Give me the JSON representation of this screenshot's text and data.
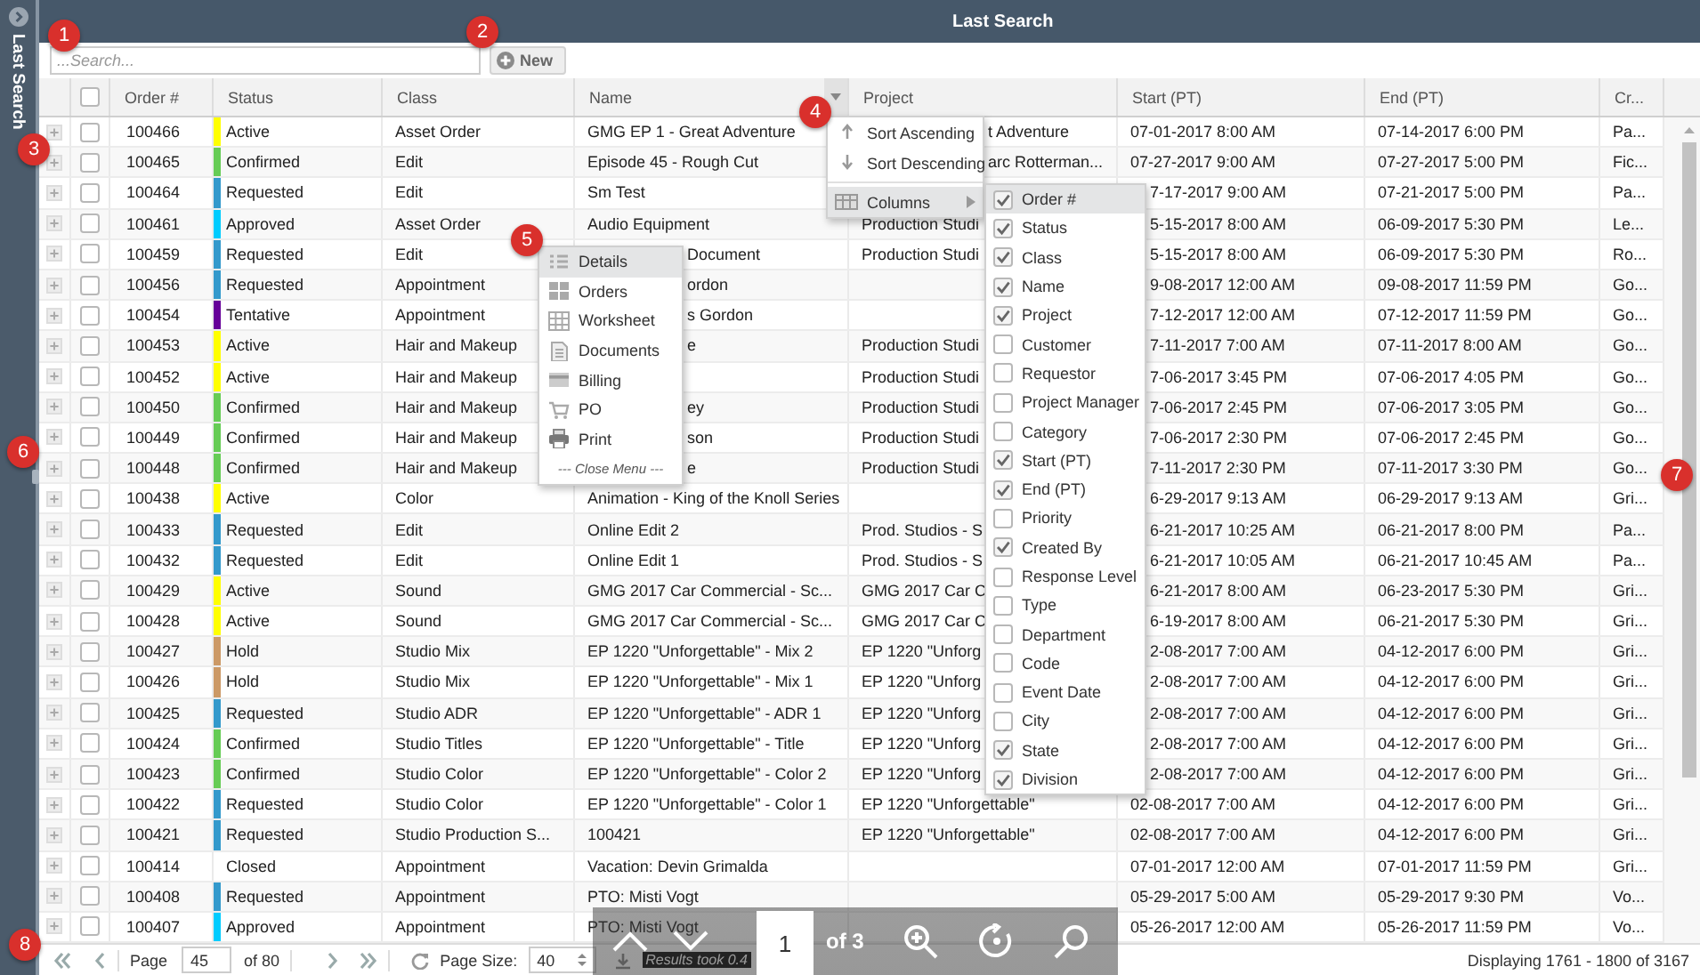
{
  "sidebar": {
    "title": "Last Search"
  },
  "window": {
    "title": "Last Search"
  },
  "search": {
    "placeholder": "...Search..."
  },
  "new_button": {
    "label": "New"
  },
  "table": {
    "header_checked": false,
    "columns": [
      "Order #",
      "Status",
      "Class",
      "Name",
      "Project",
      "Start (PT)",
      "End (PT)",
      "Cr..."
    ],
    "rows": [
      {
        "checked": false,
        "color": "#ffff00",
        "cells": [
          "100466",
          "Active",
          "Asset Order",
          "GMG EP 1 - Great Adventure",
          "t Adventure",
          "07-01-2017 8:00 AM",
          "07-14-2017 6:00 PM",
          "Pa..."
        ]
      },
      {
        "checked": false,
        "color": "#66cc55",
        "cells": [
          "100465",
          "Confirmed",
          "Edit",
          "Episode 45 - Rough Cut",
          "arc Rotterman...",
          "07-27-2017 9:00 AM",
          "07-27-2017 5:00 PM",
          "Fic..."
        ]
      },
      {
        "checked": false,
        "color": "#3399cc",
        "cells": [
          "100464",
          "Requested",
          "Edit",
          "Sm Test",
          null,
          "7-17-2017 9:00 AM",
          "07-21-2017 5:00 PM",
          "Pa..."
        ]
      },
      {
        "checked": false,
        "color": "#00ccff",
        "cells": [
          "100461",
          "Approved",
          "Asset Order",
          "Audio Equipment",
          "Production Studi",
          "5-15-2017 8:00 AM",
          "06-09-2017 5:30 PM",
          "Le..."
        ]
      },
      {
        "checked": false,
        "color": "#3399cc",
        "cells": [
          "100459",
          "Requested",
          "Edit",
          "Document",
          "Production Studi",
          "5-15-2017 8:00 AM",
          "06-09-2017 5:30 PM",
          "Ro..."
        ]
      },
      {
        "checked": false,
        "color": "#3399cc",
        "cells": [
          "100456",
          "Requested",
          "Appointment",
          "ordon",
          null,
          "9-08-2017 12:00 AM",
          "09-08-2017 11:59 PM",
          "Go..."
        ]
      },
      {
        "checked": false,
        "color": "#660099",
        "cells": [
          "100454",
          "Tentative",
          "Appointment",
          "s Gordon",
          null,
          "7-12-2017 12:00 AM",
          "07-12-2017 11:59 PM",
          "Go..."
        ]
      },
      {
        "checked": false,
        "color": "#ffff00",
        "cells": [
          "100453",
          "Active",
          "Hair and Makeup",
          "e",
          "Production Studi",
          "7-11-2017 7:00 AM",
          "07-11-2017 8:00 AM",
          "Go..."
        ]
      },
      {
        "checked": false,
        "color": "#ffff00",
        "cells": [
          "100452",
          "Active",
          "Hair and Makeup",
          null,
          "Production Studi",
          "7-06-2017 3:45 PM",
          "07-06-2017 4:05 PM",
          "Go..."
        ]
      },
      {
        "checked": false,
        "color": "#66cc55",
        "cells": [
          "100450",
          "Confirmed",
          "Hair and Makeup",
          "ey",
          "Production Studi",
          "7-06-2017 2:45 PM",
          "07-06-2017 3:05 PM",
          "Go..."
        ]
      },
      {
        "checked": false,
        "color": "#66cc55",
        "cells": [
          "100449",
          "Confirmed",
          "Hair and Makeup",
          "son",
          "Production Studi",
          "7-06-2017 2:30 PM",
          "07-06-2017 2:45 PM",
          "Go..."
        ]
      },
      {
        "checked": false,
        "color": "#66cc55",
        "cells": [
          "100448",
          "Confirmed",
          "Hair and Makeup",
          "e",
          "Production Studi",
          "7-11-2017 2:30 PM",
          "07-11-2017 3:30 PM",
          "Go..."
        ]
      },
      {
        "checked": false,
        "color": "#ffff00",
        "cells": [
          "100438",
          "Active",
          "Color",
          "Animation - King of the Knoll Series",
          null,
          "6-29-2017 9:13 AM",
          "06-29-2017 9:13 AM",
          "Gri..."
        ]
      },
      {
        "checked": false,
        "color": "#3399cc",
        "cells": [
          "100433",
          "Requested",
          "Edit",
          "Online Edit 2",
          "Prod. Studios - S",
          "6-21-2017 10:25 AM",
          "06-21-2017 8:00 PM",
          "Pa..."
        ]
      },
      {
        "checked": false,
        "color": "#3399cc",
        "cells": [
          "100432",
          "Requested",
          "Edit",
          "Online Edit 1",
          "Prod. Studios - S",
          "6-21-2017 10:05 AM",
          "06-21-2017 10:45 AM",
          "Pa..."
        ]
      },
      {
        "checked": false,
        "color": "#ffff00",
        "cells": [
          "100429",
          "Active",
          "Sound",
          "GMG 2017 Car Commercial - Sc...",
          "GMG 2017 Car C",
          "6-21-2017 8:00 AM",
          "06-23-2017 5:30 PM",
          "Gri..."
        ]
      },
      {
        "checked": false,
        "color": "#ffff00",
        "cells": [
          "100428",
          "Active",
          "Sound",
          "GMG 2017 Car Commercial - Sc...",
          "GMG 2017 Car C",
          "6-19-2017 8:00 AM",
          "06-21-2017 5:30 PM",
          "Gri..."
        ]
      },
      {
        "checked": false,
        "color": "#cc9966",
        "cells": [
          "100427",
          "Hold",
          "Studio Mix",
          "EP 1220 \"Unforgettable\" - Mix 2",
          "EP 1220 \"Unforg",
          "2-08-2017 7:00 AM",
          "04-12-2017 6:00 PM",
          "Gri..."
        ]
      },
      {
        "checked": false,
        "color": "#cc9966",
        "cells": [
          "100426",
          "Hold",
          "Studio Mix",
          "EP 1220 \"Unforgettable\" - Mix 1",
          "EP 1220 \"Unforg",
          "2-08-2017 7:00 AM",
          "04-12-2017 6:00 PM",
          "Gri..."
        ]
      },
      {
        "checked": false,
        "color": "#3399cc",
        "cells": [
          "100425",
          "Requested",
          "Studio ADR",
          "EP 1220 \"Unforgettable\" - ADR 1",
          "EP 1220 \"Unforg",
          "2-08-2017 7:00 AM",
          "04-12-2017 6:00 PM",
          "Gri..."
        ]
      },
      {
        "checked": false,
        "color": "#66cc55",
        "cells": [
          "100424",
          "Confirmed",
          "Studio Titles",
          "EP 1220 \"Unforgettable\" - Title",
          "EP 1220 \"Unforg",
          "2-08-2017 7:00 AM",
          "04-12-2017 6:00 PM",
          "Gri..."
        ]
      },
      {
        "checked": false,
        "color": "#66cc55",
        "cells": [
          "100423",
          "Confirmed",
          "Studio Color",
          "EP 1220 \"Unforgettable\" - Color 2",
          "EP 1220 \"Unforg",
          "2-08-2017 7:00 AM",
          "04-12-2017 6:00 PM",
          "Gri..."
        ]
      },
      {
        "checked": false,
        "color": "#3399cc",
        "cells": [
          "100422",
          "Requested",
          "Studio Color",
          "EP 1220 \"Unforgettable\" - Color 1",
          "EP 1220 \"Unforgettable\"",
          "02-08-2017 7:00 AM",
          "04-12-2017 6:00 PM",
          "Gri..."
        ]
      },
      {
        "checked": false,
        "color": "#3399cc",
        "cells": [
          "100421",
          "Requested",
          "Studio Production S...",
          "100421",
          "EP 1220 \"Unforgettable\"",
          "02-08-2017 7:00 AM",
          "04-12-2017 6:00 PM",
          "Gri..."
        ]
      },
      {
        "checked": false,
        "cells": [
          "100414",
          "Closed",
          "Appointment",
          "Vacation: Devin Grimalda",
          null,
          "07-01-2017 12:00 AM",
          "07-01-2017 11:59 PM",
          "Gri..."
        ]
      },
      {
        "checked": false,
        "color": "#3399cc",
        "cells": [
          "100408",
          "Requested",
          "Appointment",
          "PTO: Misti Vogt",
          null,
          "05-29-2017 5:00 AM",
          "05-29-2017 9:30 PM",
          "Vo..."
        ]
      },
      {
        "checked": false,
        "color": "#00ccff",
        "cells": [
          "100407",
          "Approved",
          "Appointment",
          "PTO: Misti Vogt",
          null,
          "05-26-2017 12:00 AM",
          "05-26-2017 11:59 PM",
          "Vo..."
        ]
      }
    ]
  },
  "sort_menu": {
    "items": [
      {
        "kind": "ascending",
        "label": "Sort Ascending",
        "selected": false
      },
      {
        "kind": "descending",
        "label": "Sort Descending",
        "selected": false
      },
      {
        "kind": "submenu",
        "label": "Columns",
        "selected": true
      }
    ]
  },
  "columns_menu": {
    "items": [
      {
        "label": "Order #",
        "checked": true,
        "selected": true
      },
      {
        "label": "Status",
        "checked": true,
        "selected": false
      },
      {
        "label": "Class",
        "checked": true,
        "selected": false
      },
      {
        "label": "Name",
        "checked": true,
        "selected": false
      },
      {
        "label": "Project",
        "checked": true,
        "selected": false
      },
      {
        "label": "Customer",
        "checked": false,
        "selected": false
      },
      {
        "label": "Requestor",
        "checked": false,
        "selected": false
      },
      {
        "label": "Project Manager",
        "checked": false,
        "selected": false
      },
      {
        "label": "Category",
        "checked": false,
        "selected": false
      },
      {
        "label": "Start (PT)",
        "checked": true,
        "selected": false
      },
      {
        "label": "End (PT)",
        "checked": true,
        "selected": false
      },
      {
        "label": "Priority",
        "checked": false,
        "selected": false
      },
      {
        "label": "Created By",
        "checked": true,
        "selected": false
      },
      {
        "label": "Response Level",
        "checked": false,
        "selected": false
      },
      {
        "label": "Type",
        "checked": false,
        "selected": false
      },
      {
        "label": "Department",
        "checked": false,
        "selected": false
      },
      {
        "label": "Code",
        "checked": false,
        "selected": false
      },
      {
        "label": "Event Date",
        "checked": false,
        "selected": false
      },
      {
        "label": "City",
        "checked": false,
        "selected": false
      },
      {
        "label": "State",
        "checked": true,
        "selected": false
      },
      {
        "label": "Division",
        "checked": true,
        "selected": false
      }
    ]
  },
  "actions_menu": {
    "items": [
      {
        "kind": "details",
        "label": "Details",
        "selected": true
      },
      {
        "kind": "orders",
        "label": "Orders",
        "selected": false
      },
      {
        "kind": "worksheet",
        "label": "Worksheet",
        "selected": false
      },
      {
        "kind": "documents",
        "label": "Documents",
        "selected": false
      },
      {
        "kind": "billing",
        "label": "Billing",
        "selected": false
      },
      {
        "kind": "po",
        "label": "PO",
        "selected": false
      },
      {
        "kind": "print",
        "label": "Print",
        "selected": false
      },
      {
        "kind": "close",
        "label": "--- Close Menu ---",
        "selected": false
      }
    ]
  },
  "pager": {
    "page_label": "Page",
    "page": "45",
    "of": "of 80",
    "page_size_label": "Page Size:",
    "page_size": "40",
    "results": "Results took 0.4",
    "displaying": "Displaying 1761 - 1800 of 3167"
  },
  "viewer": {
    "page": "1",
    "of": "of 3"
  },
  "badges": [
    "1",
    "2",
    "3",
    "4",
    "5",
    "6",
    "7",
    "8"
  ]
}
